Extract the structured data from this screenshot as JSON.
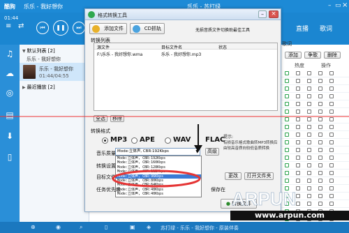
{
  "app": {
    "logo": "酷狗",
    "now_playing": "乐乐 - 我好想你",
    "song_title": "乐乐 - 苏打绿",
    "tabs": [
      "直播",
      "歌词"
    ],
    "window_controls": [
      "minimize-icon",
      "restore-icon",
      "close-icon"
    ]
  },
  "player": {
    "time": "01:44",
    "controls": [
      "prev-icon",
      "pause-icon",
      "next-icon"
    ]
  },
  "playlist": {
    "header": "默认列表 [2]",
    "current_song_line1": "乐乐 - 我好想你",
    "current_song_line2": "01:44/04:55",
    "recent_header": "最近播放 [2]",
    "song_item": "乐乐 - 我好想你"
  },
  "right_pane": {
    "header": "歌词",
    "buttons": [
      "添加",
      "争歌",
      "删除"
    ],
    "columns": [
      "热度",
      "操作"
    ]
  },
  "bottom": {
    "now_playing": "苏打绿 - 乐乐 - 我好想你 - 原装伴奏",
    "icons": [
      "add-icon",
      "locate-icon",
      "search-icon",
      "mobile-icon",
      "screen-icon",
      "mode-icon"
    ]
  },
  "dialog": {
    "title": "格式转换工具",
    "add_file": "添加文件",
    "cd_rip": "CD抓轨",
    "tip": "无损音质文件切换助最佳工具",
    "list_label": "转换列表",
    "columns": [
      "源文件",
      "目标文件名",
      "状态"
    ],
    "file_row": {
      "source": "F:\\乐乐 - 我好想你.wma",
      "target": "乐乐 - 我好想你.mp3"
    },
    "select_all": "全选",
    "remove": "移除",
    "format_label": "转换格式",
    "formats": [
      "MP3",
      "APE",
      "WAV",
      "FLAC"
    ],
    "selected_format": "MP3",
    "quality_label": "音乐质量",
    "quality_value": "Mode:立体声, CBR:192Kbps",
    "quality_options": [
      "Mode:立体声, CBR:192Kbps",
      "Mode:立体声, CBR:160Kbps",
      "Mode:立体声, CBR:128Kbps",
      "Mode:立体声, CBR:112Kbps",
      "Mode:立体声, CBR:96Kbps",
      "Mode:立体声, CBR:80Kbps",
      "Mode:立体声, CBR:64Kbps",
      "Mode:立体声, CBR:48Kbps",
      "Mode:立体声, CBR:40Kbps"
    ],
    "selected_option_index": 4,
    "advanced": "高级",
    "settings_label": "转换设置",
    "target_label": "目标文件",
    "change": "更改",
    "open_folder": "打开文件夹",
    "task_label": "任务优先级",
    "save_as": "保存在",
    "convert": "转换文件",
    "hint_title": "提示:",
    "hint_body": "有损音乐格式歌曲转MP3转换后由较高音质向较低音质转换"
  },
  "watermark": {
    "logo": "ARPUN",
    "url": "www.arpun.com"
  },
  "colors": {
    "accent": "#1b86d1",
    "highlight_ring": "#e53535",
    "guide_line": "#e33"
  }
}
